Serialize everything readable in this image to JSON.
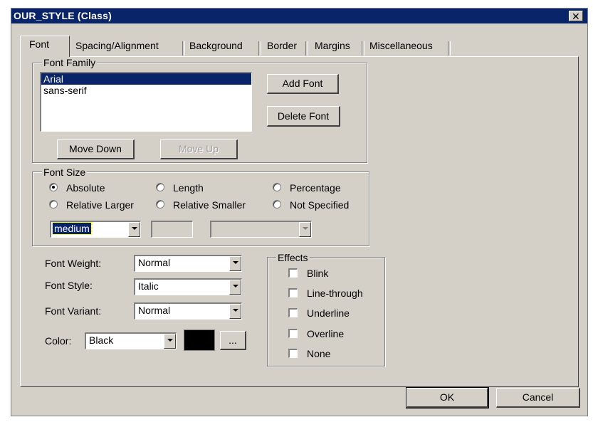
{
  "window": {
    "title": "OUR_STYLE (Class)",
    "close_glyph": "✕"
  },
  "tabs": [
    {
      "label": "Font"
    },
    {
      "label": "Spacing/Alignment"
    },
    {
      "label": "Background"
    },
    {
      "label": "Border"
    },
    {
      "label": "Margins"
    },
    {
      "label": "Miscellaneous"
    }
  ],
  "font_family": {
    "legend": "Font Family",
    "items": [
      "Arial",
      "sans-serif"
    ],
    "selected": "Arial",
    "add_button": "Add Font",
    "delete_button": "Delete Font",
    "move_down_button": "Move Down",
    "move_up_button": "Move Up"
  },
  "font_size": {
    "legend": "Font Size",
    "options": [
      "Absolute",
      "Length",
      "Percentage",
      "Relative Larger",
      "Relative Smaller",
      "Not Specified"
    ],
    "selected": "Absolute",
    "absolute_value": "medium"
  },
  "font_weight": {
    "label": "Font Weight:",
    "value": "Normal"
  },
  "font_style": {
    "label": "Font Style:",
    "value": "Italic"
  },
  "font_variant": {
    "label": "Font Variant:",
    "value": "Normal"
  },
  "color": {
    "label": "Color:",
    "value": "Black",
    "swatch": "#000000",
    "more_button": "..."
  },
  "effects": {
    "legend": "Effects",
    "items": [
      "Blink",
      "Line-through",
      "Underline",
      "Overline",
      "None"
    ]
  },
  "footer": {
    "ok_button": "OK",
    "cancel_button": "Cancel"
  },
  "colors": {
    "title_bar": "#0a246a",
    "dialog_face": "#d4d0c8",
    "selection": "#0a246a"
  }
}
